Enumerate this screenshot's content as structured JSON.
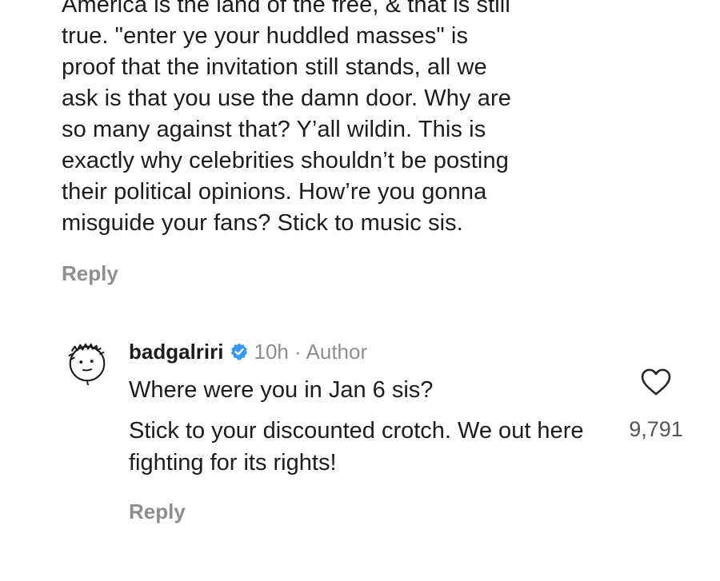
{
  "parent_comment": {
    "text": "America is the land of the free, & that is still\ntrue. \"enter ye your huddled masses\"  is\nproof that the invitation still stands, all we\nask is that you use the damn door. Why are\nso many against that? Y’all wildin. This is\nexactly why celebrities shouldn’t be posting\ntheir political opinions. How’re you gonna\nmisguide your fans? Stick to music sis.",
    "reply_label": "Reply"
  },
  "reply_comment": {
    "username": "badgalriri",
    "verified_icon": "verified-badge-icon",
    "time_author": "10h · Author",
    "line1": "Where were you in Jan 6 sis?",
    "line2": "Stick to your discounted crotch. We out here fighting for its rights!",
    "reply_label": "Reply",
    "like_icon": "heart-icon",
    "like_count": "9,791"
  },
  "colors": {
    "text": "#1c1c1c",
    "muted": "#8e8e8e",
    "verified": "#3897f0"
  }
}
